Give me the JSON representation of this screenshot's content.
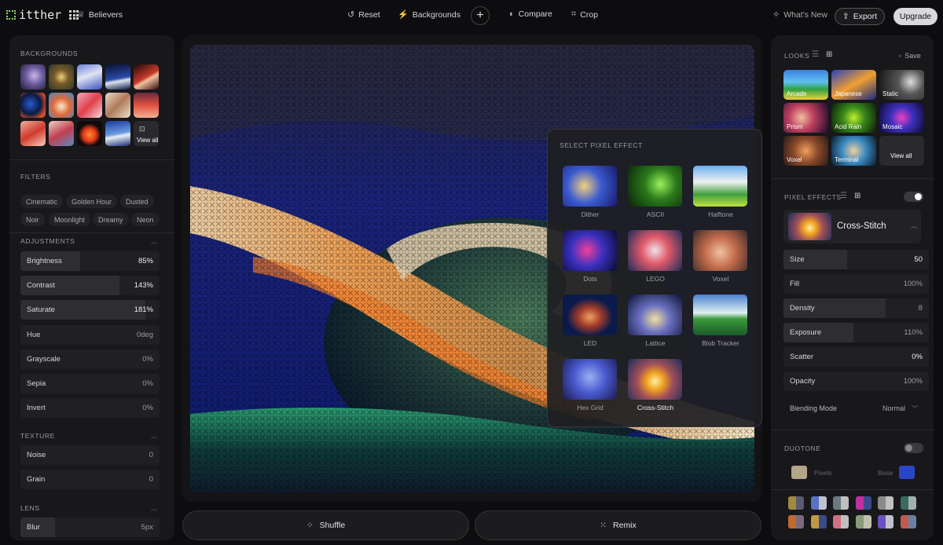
{
  "topbar": {
    "logo_text": "itther",
    "workspace": "Believers",
    "reset": "Reset",
    "backgrounds": "Backgrounds",
    "compare": "Compare",
    "crop": "Crop",
    "whats_new": "What's New",
    "export": "Export",
    "upgrade": "Upgrade"
  },
  "left": {
    "backgrounds_title": "BACKGROUNDS",
    "view_all": "View all",
    "filters_title": "FILTERS",
    "filters": [
      "Cinematic",
      "Golden Hour",
      "Dusted",
      "Noir",
      "Moonlight",
      "Dreamy",
      "Neon"
    ],
    "adjustments_title": "ADJUSTMENTS",
    "adjustments": [
      {
        "label": "Brightness",
        "value": "85%",
        "fill": 0.43,
        "hi": true
      },
      {
        "label": "Contrast",
        "value": "143%",
        "fill": 0.71,
        "hi": true
      },
      {
        "label": "Saturate",
        "value": "181%",
        "fill": 0.9,
        "hi": true
      },
      {
        "label": "Hue",
        "value": "0deg",
        "fill": 0,
        "hi": false
      },
      {
        "label": "Grayscale",
        "value": "0%",
        "fill": 0,
        "hi": false
      },
      {
        "label": "Sepia",
        "value": "0%",
        "fill": 0,
        "hi": false
      },
      {
        "label": "Invert",
        "value": "0%",
        "fill": 0,
        "hi": false
      }
    ],
    "texture_title": "TEXTURE",
    "texture": [
      {
        "label": "Noise",
        "value": "0",
        "fill": 0
      },
      {
        "label": "Grain",
        "value": "0",
        "fill": 0
      }
    ],
    "lens_title": "LENS",
    "lens": [
      {
        "label": "Blur",
        "value": "5px",
        "fill": 0.25
      }
    ]
  },
  "popup": {
    "title": "SELECT PIXEL EFFECT",
    "effects": [
      "Dither",
      "ASCII",
      "Halftone",
      "Dots",
      "LEGO",
      "Voxel",
      "LED",
      "Lattice",
      "Blob Tracker",
      "Hex Grid",
      "Cross-Stitch"
    ],
    "selected": "Cross-Stitch"
  },
  "bottom": {
    "shuffle": "Shuffle",
    "remix": "Remix"
  },
  "right": {
    "looks_title": "LOOKS",
    "save": "Save",
    "looks": [
      "Arcade",
      "Japanese",
      "Static",
      "Prism",
      "Acid Rain",
      "Mosaic",
      "Voxel",
      "Terminal",
      "View all"
    ],
    "pixel_effects_title": "PIXEL EFFECTS",
    "current_effect": "Cross-Stitch",
    "params": [
      {
        "label": "Size",
        "value": "50",
        "fill": 0.44,
        "hi": true
      },
      {
        "label": "Fill",
        "value": "100%",
        "fill": 0,
        "hi": false
      },
      {
        "label": "Density",
        "value": "8",
        "fill": 0.7,
        "hi": false
      },
      {
        "label": "Exposure",
        "value": "110%",
        "fill": 0.48,
        "hi": false
      },
      {
        "label": "Scatter",
        "value": "0%",
        "fill": 0,
        "hi": true
      },
      {
        "label": "Opacity",
        "value": "100%",
        "fill": 0.0,
        "hi": false
      }
    ],
    "blending_label": "Blending Mode",
    "blending_value": "Normal",
    "duotone_title": "DUOTONE",
    "pixels_label": "Pixels",
    "base_label": "Base",
    "pixels_color": "#b3a58a",
    "base_color": "#2a46c8"
  }
}
